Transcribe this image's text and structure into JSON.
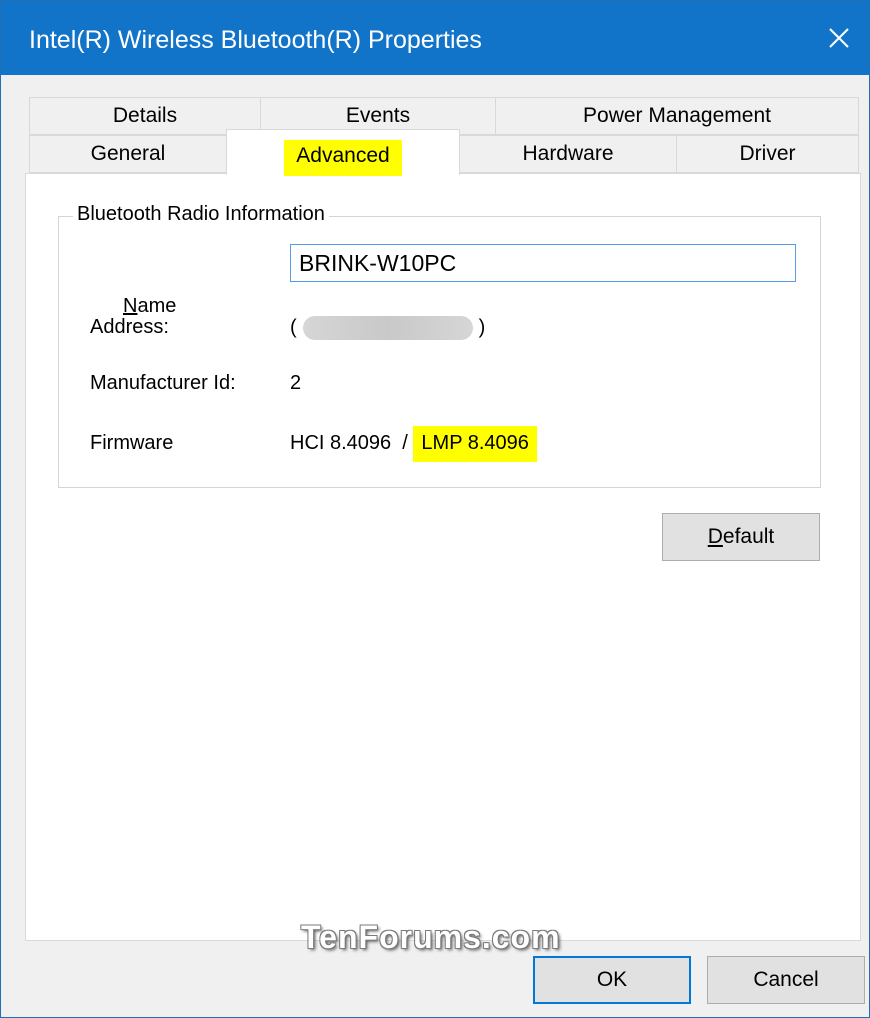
{
  "window": {
    "title": "Intel(R) Wireless Bluetooth(R) Properties"
  },
  "tabs": {
    "row1": [
      "Details",
      "Events",
      "Power Management"
    ],
    "row2": [
      "General",
      "Advanced",
      "Hardware",
      "Driver"
    ],
    "active": "Advanced"
  },
  "group": {
    "legend": "Bluetooth Radio Information",
    "name_label_first": "N",
    "name_label_rest": "ame",
    "name_value": "BRINK-W10PC",
    "address_label": "Address:",
    "address_open": "(",
    "address_close": ")",
    "manufacturer_label": "Manufacturer Id:",
    "manufacturer_value": "2",
    "firmware_label": "Firmware",
    "firmware_hci": "HCI 8.4096",
    "firmware_sep": "/",
    "firmware_lmp": "LMP 8.4096"
  },
  "buttons": {
    "default_first": "D",
    "default_rest": "efault",
    "ok": "OK",
    "cancel": "Cancel"
  },
  "watermark": "TenForums.com",
  "colors": {
    "titlebar": "#1274c8",
    "highlight": "#ffff00",
    "focus_border": "#0078d7"
  }
}
